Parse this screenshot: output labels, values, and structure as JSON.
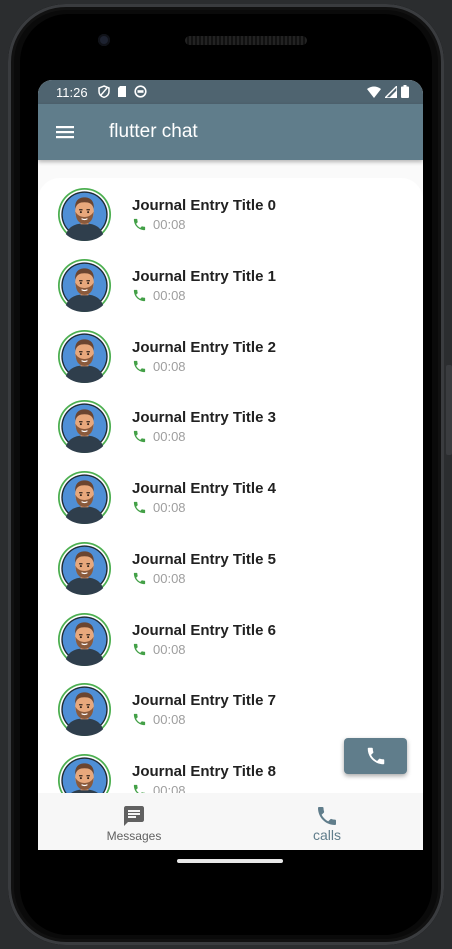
{
  "status_bar": {
    "time": "11:26"
  },
  "app_bar": {
    "title": "flutter chat",
    "menu_icon": "menu-icon"
  },
  "entries": [
    {
      "title": "Journal Entry Title 0",
      "duration": "00:08"
    },
    {
      "title": "Journal Entry Title 1",
      "duration": "00:08"
    },
    {
      "title": "Journal Entry Title 2",
      "duration": "00:08"
    },
    {
      "title": "Journal Entry Title 3",
      "duration": "00:08"
    },
    {
      "title": "Journal Entry Title 4",
      "duration": "00:08"
    },
    {
      "title": "Journal Entry Title 5",
      "duration": "00:08"
    },
    {
      "title": "Journal Entry Title 6",
      "duration": "00:08"
    },
    {
      "title": "Journal Entry Title 7",
      "duration": "00:08"
    },
    {
      "title": "Journal Entry Title 8",
      "duration": "00:08"
    }
  ],
  "fab": {
    "icon": "phone-icon"
  },
  "bottom_nav": {
    "items": [
      {
        "label": "Messages",
        "icon": "message-icon",
        "selected": false
      },
      {
        "label": "calls",
        "icon": "phone-icon",
        "selected": true
      }
    ]
  },
  "colors": {
    "primary": "#607d8b",
    "status_bar": "#4f6470",
    "call_green": "#43a047",
    "nav_inactive": "#616161"
  }
}
